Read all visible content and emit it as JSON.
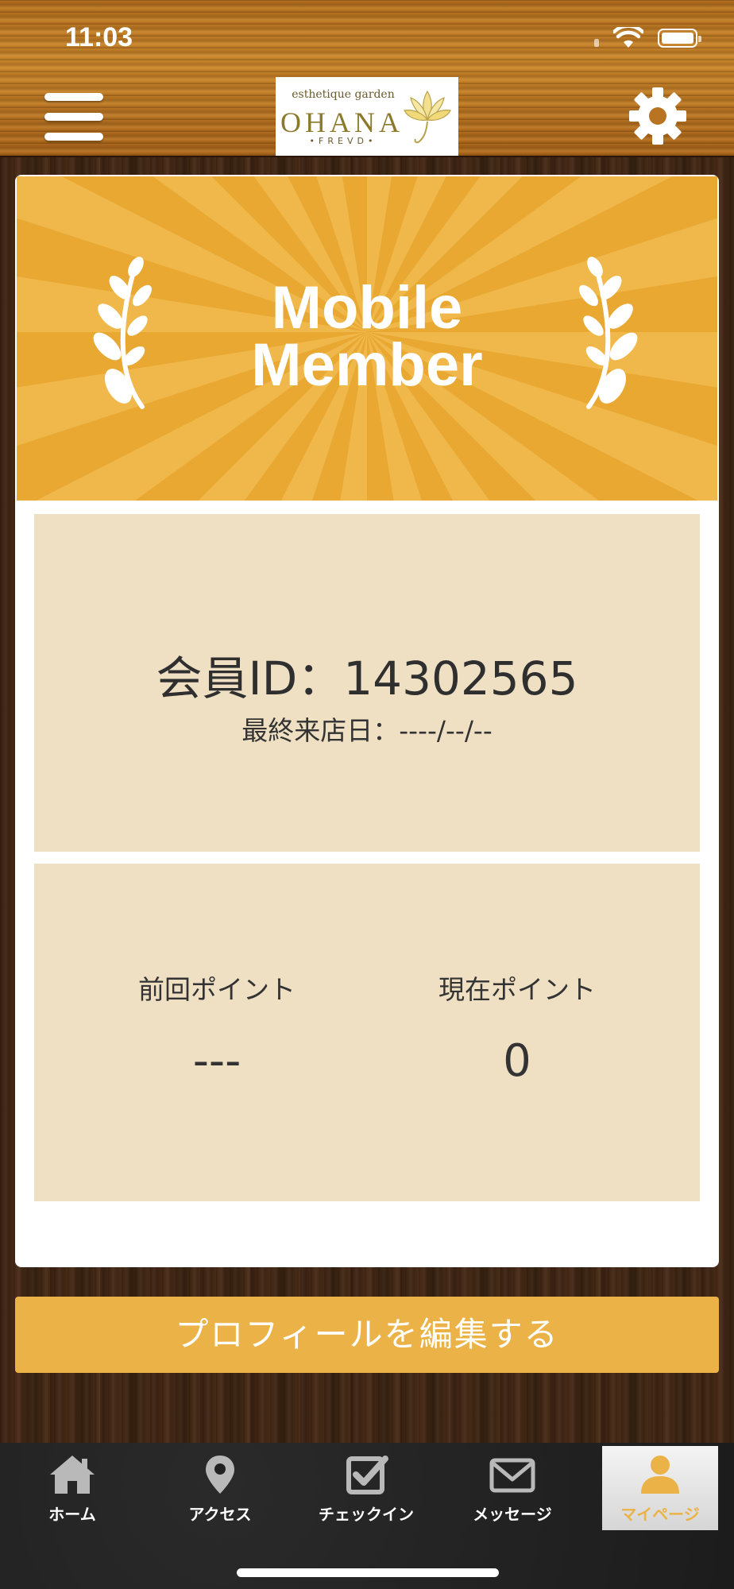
{
  "status_bar": {
    "time": "11:03"
  },
  "header": {
    "logo": {
      "small": "esthetique garden",
      "main": "OHANA",
      "sub": "•FREVD•"
    }
  },
  "banner": {
    "line1": "Mobile",
    "line2": "Member"
  },
  "member": {
    "id_text": "会員ID：14302565",
    "last_visit_text": "最終来店日：----/--/--"
  },
  "points": {
    "previous": {
      "label": "前回ポイント",
      "value": "---"
    },
    "current": {
      "label": "現在ポイント",
      "value": "0"
    }
  },
  "edit_profile_label": "プロフィールを編集する",
  "tabs": [
    {
      "label": "ホーム",
      "icon": "home-icon"
    },
    {
      "label": "アクセス",
      "icon": "map-pin-icon"
    },
    {
      "label": "チェックイン",
      "icon": "checkbox-icon"
    },
    {
      "label": "メッセージ",
      "icon": "envelope-icon"
    },
    {
      "label": "マイページ",
      "icon": "person-icon",
      "active": true
    }
  ],
  "colors": {
    "accent": "#ebb347",
    "panel": "#efe0c4",
    "banner_light": "#f0b84a",
    "banner_dark": "#e8a832"
  }
}
